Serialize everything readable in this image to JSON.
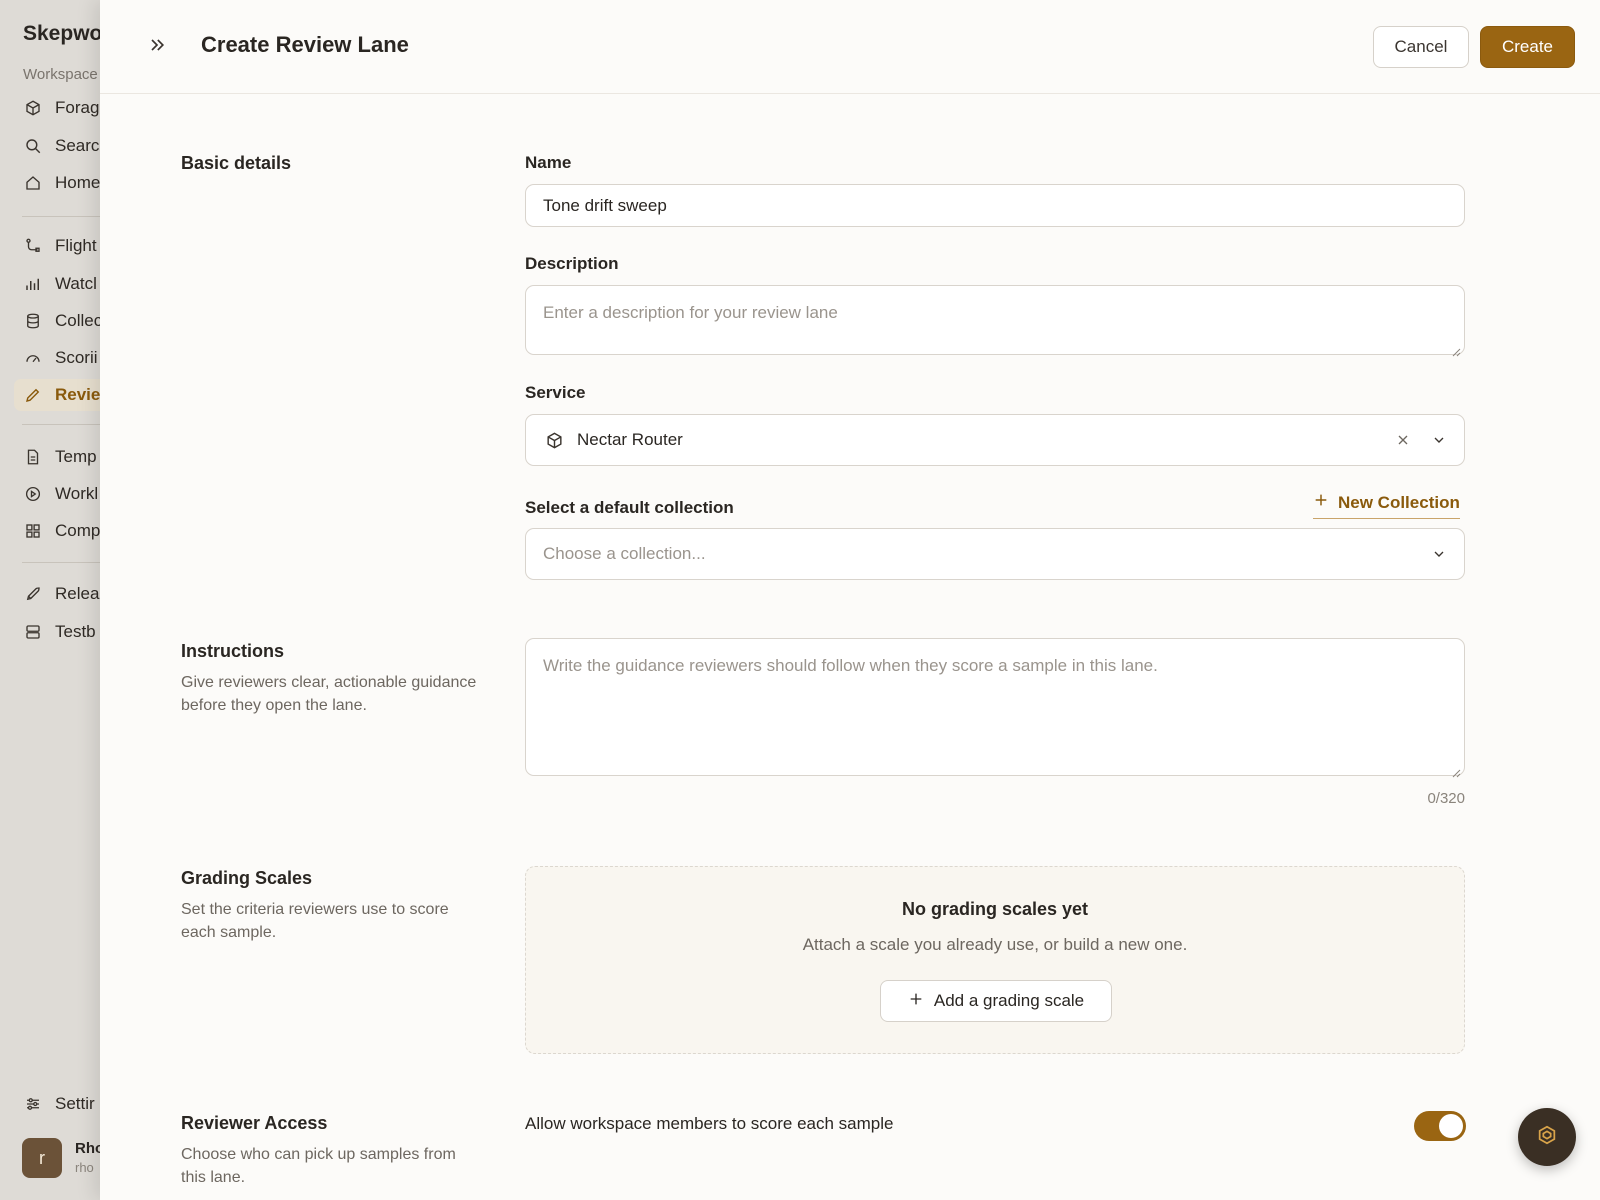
{
  "sidebar": {
    "brand": "Skepwo",
    "workspace_label": "Workspace",
    "items": [
      {
        "label": "Forag",
        "icon": "cube-icon"
      },
      {
        "label": "Searc",
        "icon": "search-icon"
      },
      {
        "label": "Home",
        "icon": "home-icon"
      },
      {
        "label": "Flight",
        "icon": "flow-icon"
      },
      {
        "label": "Watcl",
        "icon": "bar-chart-icon"
      },
      {
        "label": "Collec",
        "icon": "database-icon"
      },
      {
        "label": "Scorii",
        "icon": "gauge-icon"
      },
      {
        "label": "Revie",
        "icon": "pencil-icon",
        "active": true
      },
      {
        "label": "Temp",
        "icon": "document-icon"
      },
      {
        "label": "Workl",
        "icon": "play-circle-icon"
      },
      {
        "label": "Comp",
        "icon": "grid-icon"
      },
      {
        "label": "Relea",
        "icon": "rocket-icon"
      },
      {
        "label": "Testb",
        "icon": "server-icon"
      },
      {
        "label": "Settir",
        "icon": "sliders-icon"
      }
    ],
    "user": {
      "initial": "r",
      "name": "Rho",
      "email": "rho"
    }
  },
  "header": {
    "title": "Create Review Lane",
    "cancel_label": "Cancel",
    "create_label": "Create"
  },
  "basic": {
    "title": "Basic details",
    "name_label": "Name",
    "name_value": "Tone drift sweep",
    "description_label": "Description",
    "description_placeholder": "Enter a description for your review lane",
    "service_label": "Service",
    "service_value": "Nectar Router",
    "collection_label": "Select a default collection",
    "new_collection_label": "New Collection",
    "collection_placeholder": "Choose a collection..."
  },
  "instructions": {
    "title": "Instructions",
    "description": "Give reviewers clear, actionable guidance before they open the lane.",
    "placeholder": "Write the guidance reviewers should follow when they score a sample in this lane.",
    "counter": "0/320"
  },
  "grading": {
    "title": "Grading Scales",
    "description": "Set the criteria reviewers use to score each sample.",
    "empty_title": "No grading scales yet",
    "empty_desc": "Attach a scale you already use, or build a new one.",
    "add_label": "Add a grading scale"
  },
  "access": {
    "title": "Reviewer Access",
    "description": "Choose who can pick up samples from this lane.",
    "toggle_label": "Allow workspace members to score each sample",
    "toggle_on": true
  },
  "colors": {
    "accent": "#9a6512",
    "sidebar_bg": "#dedbd6",
    "panel_bg": "#fcfbf9"
  }
}
